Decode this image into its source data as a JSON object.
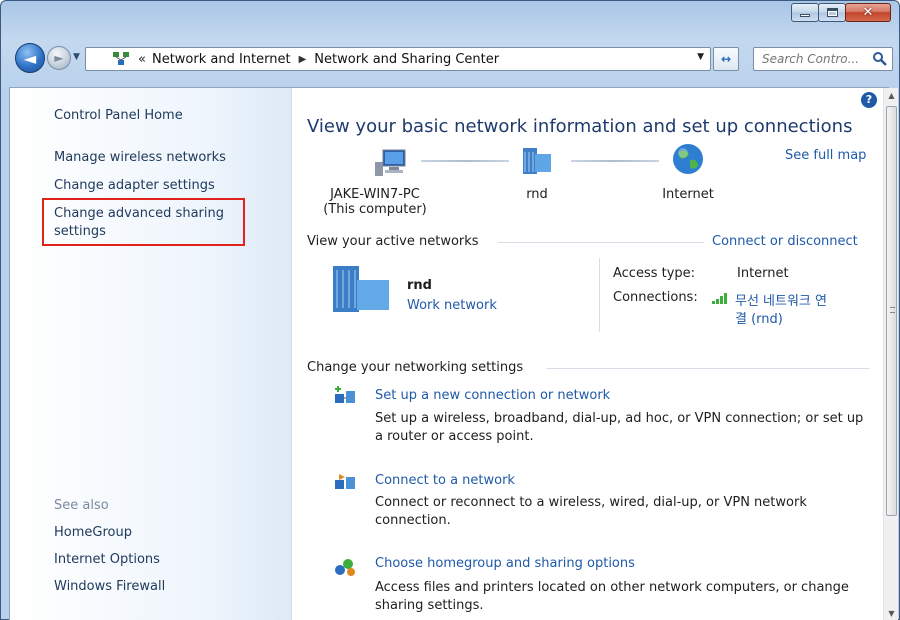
{
  "window": {
    "minimize_icon": "minimize-icon",
    "maximize_icon": "maximize-icon",
    "close_icon": "close-icon"
  },
  "nav": {
    "back_icon": "back-arrow-icon",
    "forward_icon": "forward-arrow-icon",
    "chevron": "«",
    "breadcrumbs": [
      "Network and Internet",
      "Network and Sharing Center"
    ],
    "search_placeholder": "Search Contro..."
  },
  "sidebar": {
    "items": [
      {
        "label": "Control Panel Home"
      },
      {
        "label": "Manage wireless networks"
      },
      {
        "label": "Change adapter settings"
      },
      {
        "label": "Change advanced sharing"
      },
      {
        "label": "settings"
      }
    ],
    "see_also_label": "See also",
    "see_also": [
      {
        "label": "HomeGroup"
      },
      {
        "label": "Internet Options"
      },
      {
        "label": "Windows Firewall"
      }
    ]
  },
  "main": {
    "title": "View your basic network information and set up connections",
    "see_full_map": "See full map",
    "map": {
      "computer_name": "JAKE-WIN7-PC",
      "computer_sub": "(This computer)",
      "network_name": "rnd",
      "internet_label": "Internet"
    },
    "active_networks_heading": "View your active networks",
    "connect_or_disconnect": "Connect or disconnect",
    "active_network": {
      "name": "rnd",
      "type_link": "Work network",
      "access_type_label": "Access type:",
      "access_type_value": "Internet",
      "connections_label": "Connections:",
      "connection_line1": "무선 네트워크 연",
      "connection_line2": "결 (rnd)"
    },
    "settings_heading": "Change your networking settings",
    "tasks": [
      {
        "title": "Set up a new connection or network",
        "desc": "Set up a wireless, broadband, dial-up, ad hoc, or VPN connection; or set up a router or access point."
      },
      {
        "title": "Connect to a network",
        "desc": "Connect or reconnect to a wireless, wired, dial-up, or VPN network connection."
      },
      {
        "title": "Choose homegroup and sharing options",
        "desc": "Access files and printers located on other network computers, or change sharing settings."
      }
    ]
  },
  "colors": {
    "link": "#1f5aa8",
    "highlight_box": "#e0221a",
    "title_text": "#1e3a6e"
  }
}
